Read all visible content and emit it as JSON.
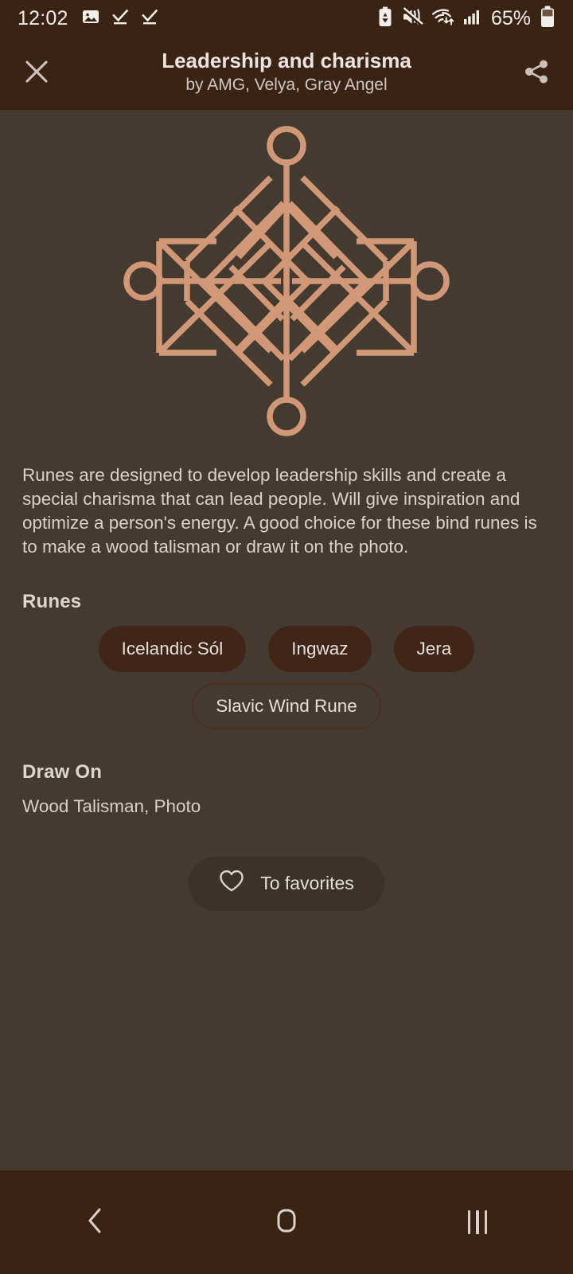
{
  "status_bar": {
    "clock": "12:02",
    "battery_percent": "65%",
    "left_icons": [
      "image-icon",
      "task-complete-icon",
      "task-complete-icon"
    ],
    "right_icons": [
      "battery-saver-icon",
      "sound-mute-icon",
      "wifi-icon",
      "cellular-signal-icon",
      "battery-icon"
    ]
  },
  "app_bar": {
    "close_label": "close-icon",
    "title": "Leadership and charisma",
    "subtitle": "by AMG, Velya, Gray Angel",
    "share_label": "share-icon"
  },
  "artwork": {
    "name": "bind-rune-artwork",
    "stroke_color": "#D09877"
  },
  "description": "Runes are designed to develop leadership skills and create a special charisma that can lead people.  Will give inspiration and optimize a person's energy.  A good choice for these bind runes is to make a wood talisman or draw it on the photo.",
  "runes_section": {
    "heading": "Runes",
    "chips": [
      {
        "label": "Icelandic Sól",
        "style": "filled"
      },
      {
        "label": "Ingwaz",
        "style": "filled"
      },
      {
        "label": "Jera",
        "style": "filled"
      },
      {
        "label": "Slavic Wind Rune",
        "style": "outlined"
      }
    ]
  },
  "draw_on_section": {
    "heading": "Draw On",
    "value": "Wood Talisman, Photo"
  },
  "favorites_button": {
    "label": "To favorites",
    "icon": "heart-outline-icon"
  },
  "nav_bar": {
    "back": "back-icon",
    "home": "home-icon",
    "recents": "recents-icon"
  },
  "colors": {
    "background": "#453A30",
    "chrome": "#3A2313",
    "accent": "#D09877",
    "chip_fill": "#412617",
    "chip_outline": "#4E2E1B",
    "text_primary": "#E4DFDA",
    "text_secondary": "#D7D1CB"
  }
}
